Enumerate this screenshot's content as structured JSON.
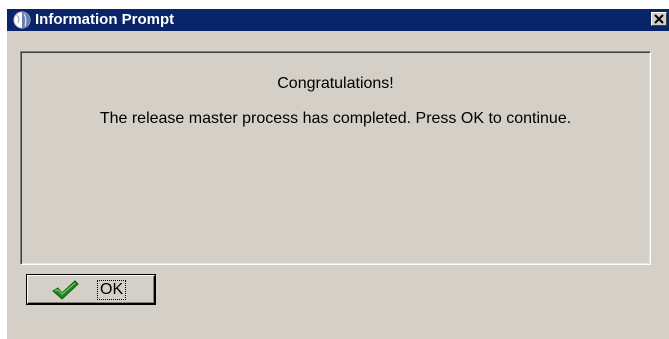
{
  "window": {
    "title": "Information Prompt",
    "title_icon": "globe-icon",
    "close_icon": "close-icon",
    "titlebar_color": "#0a246a",
    "face_color": "#d4d0c8"
  },
  "message": {
    "heading": "Congratulations!",
    "body": "The release master process has completed.  Press OK to continue."
  },
  "buttons": {
    "ok_label": "OK",
    "ok_icon": "checkmark-icon",
    "check_color": "#1f8a1f"
  }
}
